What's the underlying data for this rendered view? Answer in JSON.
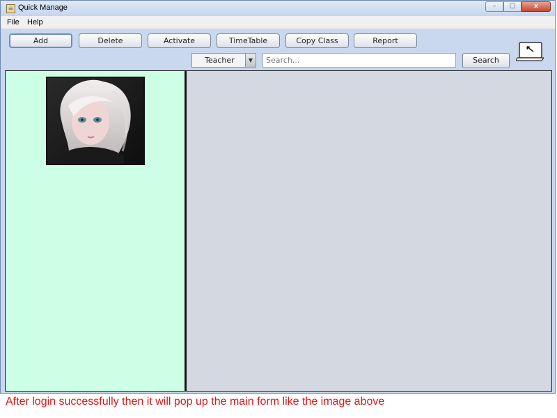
{
  "window": {
    "title": "Quick Manage",
    "controls": {
      "minimize": "–",
      "maximize": "□",
      "close": "x"
    }
  },
  "menubar": {
    "items": [
      "File",
      "Help"
    ]
  },
  "toolbar": {
    "buttons": [
      "Add",
      "Delete",
      "Activate",
      "TimeTable",
      "Copy Class",
      "Report"
    ]
  },
  "search": {
    "role_selected": "Teacher",
    "placeholder": "Search...",
    "button_label": "Search"
  },
  "icons": {
    "app": "java-app-icon",
    "logout": "laptop-arrow-icon",
    "dropdown": "chevron-down-icon"
  },
  "colors": {
    "left_panel_bg": "#ccffe6",
    "right_panel_bg": "#d4d8e0",
    "window_bg": "#c9d8ee",
    "caption_text": "#e01515"
  },
  "caption": "After login successfully then it will pop up the main form like the image above"
}
